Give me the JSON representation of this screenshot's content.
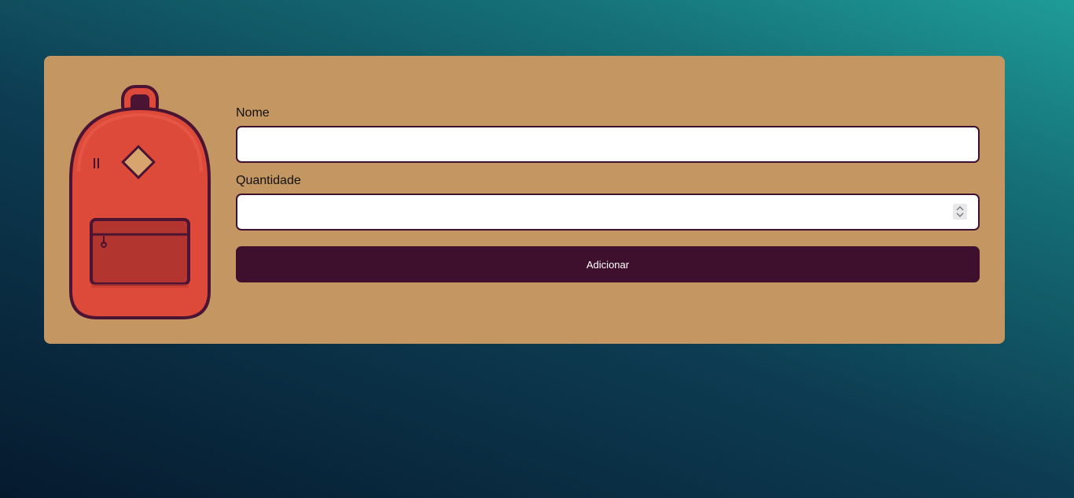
{
  "form": {
    "name_label": "Nome",
    "name_value": "",
    "quantity_label": "Quantidade",
    "quantity_value": "",
    "submit_label": "Adicionar"
  },
  "colors": {
    "card": "#c49661",
    "accent": "#3f102d",
    "backpack_body": "#dd4a3a",
    "backpack_pocket": "#b2362f"
  },
  "icons": {
    "illustration": "backpack-icon",
    "number_spinner": "spinner-arrows-icon"
  }
}
